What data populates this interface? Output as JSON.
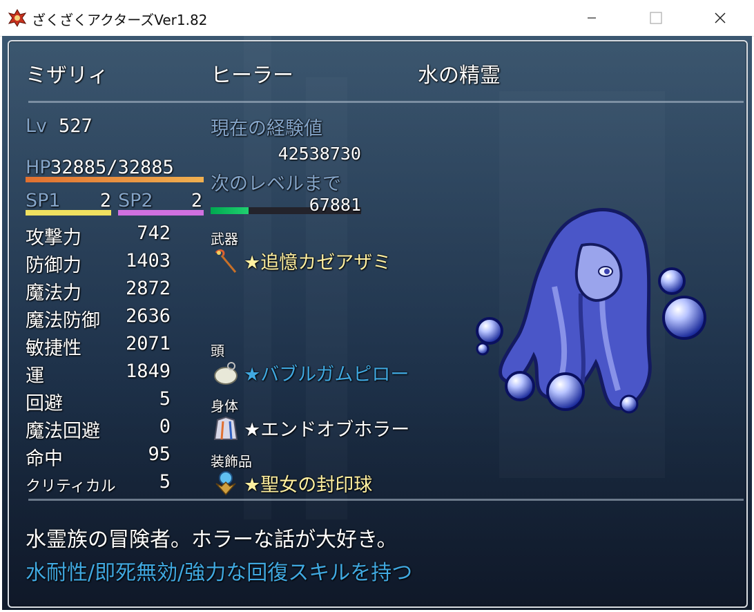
{
  "window": {
    "title": "ざくざくアクターズVer1.82"
  },
  "actor": {
    "name": "ミザリィ",
    "class": "ヒーラー",
    "nickname": "水の精霊",
    "level_label": "Lv",
    "level": "527",
    "hp_label": "HP",
    "hp_value": "32885/32885",
    "hp_fill": 1.0,
    "sp1_label": "SP1",
    "sp1_value": "2",
    "sp2_label": "SP2",
    "sp2_value": "2",
    "description_line1": "水霊族の冒険者。ホラーな話が大好き。",
    "description_line2": "水耐性/即死無効/強力な回復スキルを持つ"
  },
  "exp": {
    "current_label": "現在の経験値",
    "current_value": "42538730",
    "next_label": "次のレベルまで",
    "next_value": "67881",
    "progress_fraction": 0.25
  },
  "params": [
    {
      "label": "攻撃力",
      "value": "742"
    },
    {
      "label": "防御力",
      "value": "1403"
    },
    {
      "label": "魔法力",
      "value": "2872"
    },
    {
      "label": "魔法防御",
      "value": "2636"
    },
    {
      "label": "敏捷性",
      "value": "2071"
    },
    {
      "label": "運",
      "value": "1849"
    },
    {
      "label": "回避",
      "value": "5"
    },
    {
      "label": "魔法回避",
      "value": "0"
    },
    {
      "label": "命中",
      "value": "95"
    },
    {
      "label": "クリティカル",
      "value": "5"
    }
  ],
  "equipment": [
    {
      "slot": "武器",
      "name": "★追憶カゼアザミ",
      "color": "#fff0a0",
      "icon": "staff-icon"
    },
    {
      "slot": "頭",
      "name": "★バブルガムピロー",
      "color": "#40a8e0",
      "icon": "bubble-pillow-icon"
    },
    {
      "slot": "身体",
      "name": "★エンドオブホラー",
      "color": "#ffffff",
      "icon": "robe-icon"
    },
    {
      "slot": "装飾品",
      "name": "★聖女の封印球",
      "color": "#fff0a0",
      "icon": "orb-icon"
    }
  ],
  "colors": {
    "system_text": "#84a4c8",
    "hp_gauge": "#e8a040",
    "sp1_gauge": "#f0e060",
    "sp2_gauge": "#d070e0",
    "exp_gauge": "#10c060"
  }
}
